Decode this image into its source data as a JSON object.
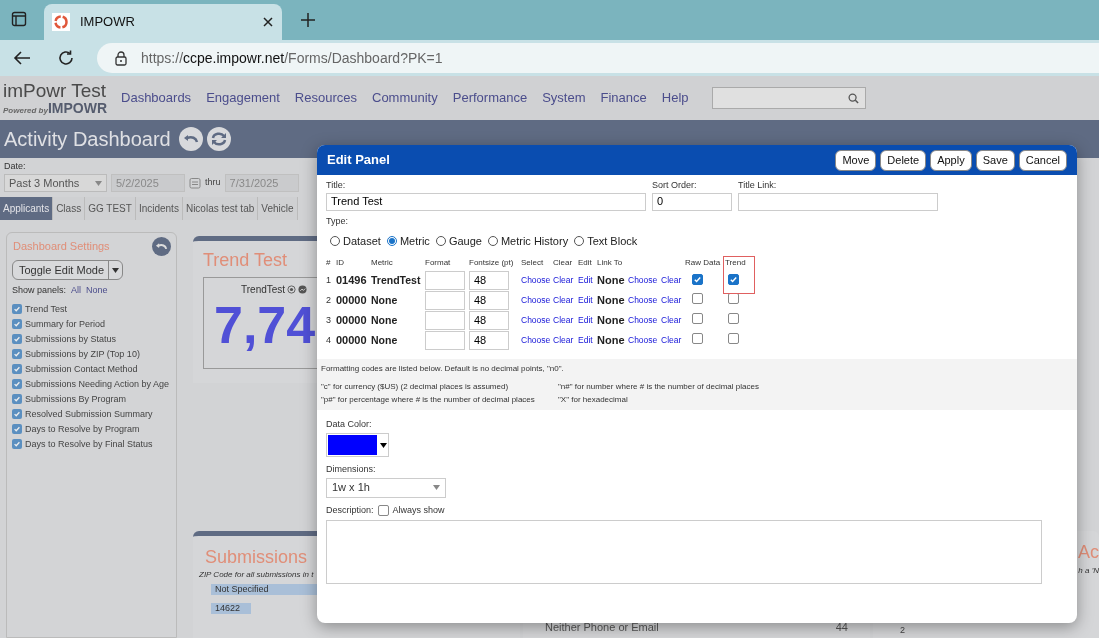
{
  "browser": {
    "tab_title": "IMPOWR",
    "url": {
      "scheme": "https://",
      "host": "ccpe.impowr.net",
      "path": "/Forms/Dashboard?PK=1"
    }
  },
  "app": {
    "logo_title": "imPowr Test",
    "logo_tagline": "Powered by",
    "logo_brand": "IMPOWR",
    "nav": [
      "Dashboards",
      "Engagement",
      "Resources",
      "Community",
      "Performance",
      "System",
      "Finance",
      "Help"
    ]
  },
  "page_title": "Activity Dashboard",
  "filters": {
    "date_label": "Date:",
    "range": "Past 3 Months",
    "from": "5/2/2025",
    "thru_label": "thru",
    "to": "7/31/2025"
  },
  "tabs": [
    {
      "label": "Applicants",
      "selected": true
    },
    {
      "label": "Class",
      "selected": false
    },
    {
      "label": "GG TEST",
      "selected": false
    },
    {
      "label": "Incidents",
      "selected": false
    },
    {
      "label": "Nicolas test tab",
      "selected": false
    },
    {
      "label": "Vehicle",
      "selected": false
    }
  ],
  "sidebar": {
    "title": "Dashboard Settings",
    "toggle_button": "Toggle Edit Mode",
    "show_panels_label": "Show panels:",
    "links": [
      "All",
      "None"
    ],
    "panels": [
      {
        "label": "Trend Test",
        "checked": true
      },
      {
        "label": "Summary for Period",
        "checked": true
      },
      {
        "label": "Submissions by Status",
        "checked": true
      },
      {
        "label": "Submissions by ZIP (Top 10)",
        "checked": true
      },
      {
        "label": "Submission Contact Method",
        "checked": true
      },
      {
        "label": "Submissions Needing Action by Age",
        "checked": true
      },
      {
        "label": "Submissions By Program",
        "checked": true
      },
      {
        "label": "Resolved Submission Summary",
        "checked": true
      },
      {
        "label": "Days to Resolve by Program",
        "checked": true
      },
      {
        "label": "Days to Resolve by Final Status",
        "checked": true
      }
    ]
  },
  "trend_card": {
    "title": "Trend Test",
    "metric_label": "TrendTest",
    "value": "7,74"
  },
  "zip_card": {
    "title": "Submissions",
    "subtitle": "ZIP Code for all submissions in t",
    "bars": [
      "Not Specified",
      "14622"
    ]
  },
  "contact_card": {
    "row_label": "Neither Phone or Email",
    "row_value": "44"
  },
  "right_card": {
    "title": "Ac",
    "subtitle": "h a 'N",
    "axis_value": "2"
  },
  "dialog": {
    "title": "Edit Panel",
    "buttons": [
      "Move",
      "Delete",
      "Apply",
      "Save",
      "Cancel"
    ],
    "title_label": "Title:",
    "title_value": "Trend Test",
    "sort_label": "Sort Order:",
    "sort_value": "0",
    "title_link_label": "Title Link:",
    "type_label": "Type:",
    "types": [
      {
        "label": "Dataset",
        "selected": false
      },
      {
        "label": "Metric",
        "selected": true
      },
      {
        "label": "Gauge",
        "selected": false
      },
      {
        "label": "Metric History",
        "selected": false
      },
      {
        "label": "Text Block",
        "selected": false
      }
    ],
    "columns": [
      "#",
      "ID",
      "Metric",
      "Format",
      "Fontsize (pt)",
      "Select",
      "Clear",
      "Edit",
      "Link To",
      "Raw Data",
      "Trend"
    ],
    "trend_highlight": true,
    "rows": [
      {
        "num": "1",
        "id": "01496",
        "metric": "TrendTest",
        "fontsize": "48",
        "choose": "Choose",
        "clear": "Clear",
        "edit": "Edit",
        "link_to": "None",
        "link_choose": "Choose",
        "link_clear": "Clear",
        "raw_data": true,
        "trend": true
      },
      {
        "num": "2",
        "id": "00000",
        "metric": "None",
        "fontsize": "48",
        "choose": "Choose",
        "clear": "Clear",
        "edit": "Edit",
        "link_to": "None",
        "link_choose": "Choose",
        "link_clear": "Clear",
        "raw_data": false,
        "trend": false
      },
      {
        "num": "3",
        "id": "00000",
        "metric": "None",
        "fontsize": "48",
        "choose": "Choose",
        "clear": "Clear",
        "edit": "Edit",
        "link_to": "None",
        "link_choose": "Choose",
        "link_clear": "Clear",
        "raw_data": false,
        "trend": false
      },
      {
        "num": "4",
        "id": "00000",
        "metric": "None",
        "fontsize": "48",
        "choose": "Choose",
        "clear": "Clear",
        "edit": "Edit",
        "link_to": "None",
        "link_choose": "Choose",
        "link_clear": "Clear",
        "raw_data": false,
        "trend": false
      }
    ],
    "format_intro": "Formatting codes are listed below. Default is no decimal points, \"n0\".",
    "format_codes": [
      "\"c\" for currency ($US) (2 decimal places is assumed)",
      "\"n#\" for number where # is the number of decimal places",
      "\"p#\" for percentage where # is the number of decimal places",
      "\"X\" for hexadecimal"
    ],
    "data_color": {
      "label": "Data Color:",
      "color": "#0000ff"
    },
    "dimensions_label": "Dimensions:",
    "dimensions_value": "1w x 1h",
    "description_label": "Description:",
    "always_show_label": "Always show",
    "always_show": false
  }
}
